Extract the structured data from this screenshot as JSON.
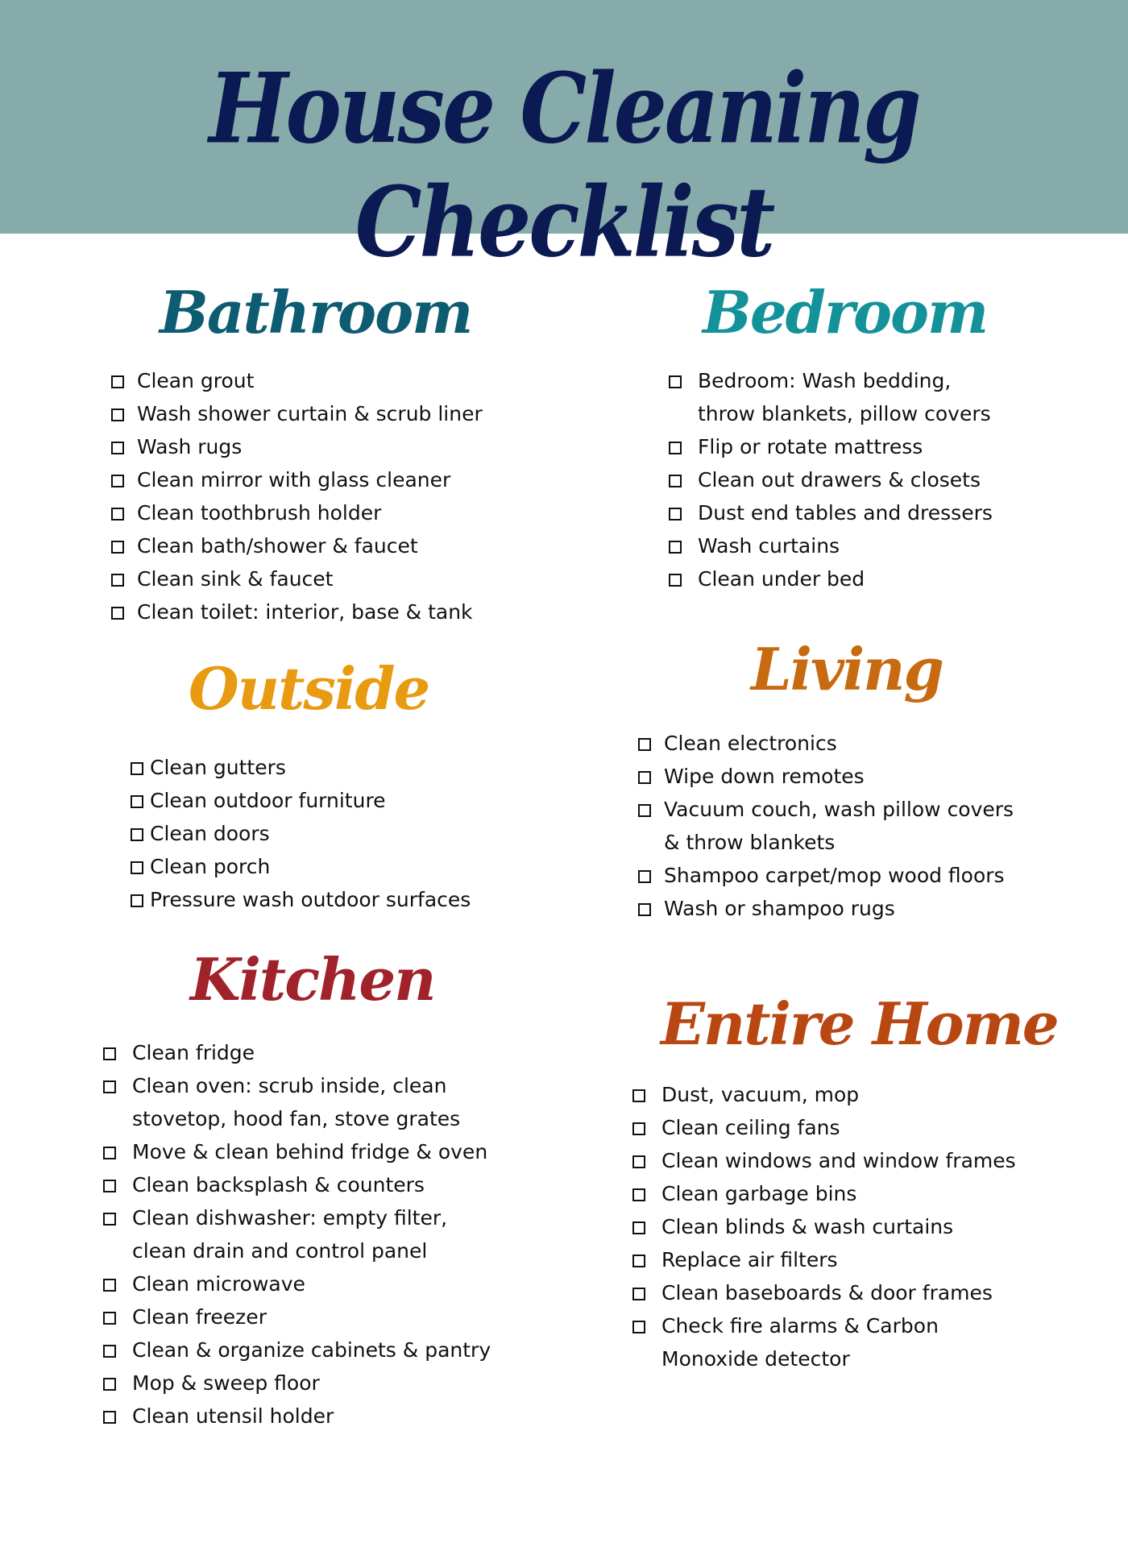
{
  "header": {
    "title": "House Cleaning Checklist",
    "background_color": "#87abaa",
    "title_color": "#0b1a52"
  },
  "sections": {
    "bathroom": {
      "heading": "Bathroom",
      "color": "#0d5c72",
      "items": [
        "Clean grout",
        "Wash shower curtain & scrub liner",
        " Wash rugs",
        "Clean mirror with glass cleaner",
        "Clean toothbrush holder",
        "Clean bath/shower & faucet",
        "Clean sink & faucet",
        "Clean toilet: interior, base & tank"
      ]
    },
    "bedroom": {
      "heading": "Bedroom",
      "color": "#14929a",
      "items": [
        "Bedroom: Wash bedding, throw blankets, pillow covers",
        "Flip or rotate mattress",
        "Clean out drawers & closets",
        "Dust end tables and dressers",
        "Wash curtains",
        "Clean under bed"
      ]
    },
    "outside": {
      "heading": "Outside",
      "color": "#e89a10",
      "items": [
        "Clean gutters",
        "Clean outdoor furniture",
        "Clean doors",
        "Clean porch",
        "Pressure wash outdoor surfaces"
      ]
    },
    "living": {
      "heading": "Living",
      "color": "#c86a10",
      "items": [
        "Clean electronics",
        "Wipe down remotes",
        "Vacuum couch, wash pillow covers & throw blankets",
        "Shampoo carpet/mop wood floors",
        "Wash or shampoo rugs"
      ]
    },
    "kitchen": {
      "heading": "Kitchen",
      "color": "#a0222a",
      "items": [
        "Clean fridge",
        "Clean oven: scrub inside, clean stovetop, hood fan, stove grates",
        "Move & clean behind fridge & oven",
        "Clean backsplash & counters",
        "Clean dishwasher: empty filter, clean drain and control panel",
        "Clean microwave",
        "Clean freezer",
        "Clean & organize cabinets & pantry",
        "Mop & sweep floor",
        "Clean utensil holder"
      ]
    },
    "entire_home": {
      "heading": "Entire Home",
      "color": "#b84712",
      "items": [
        "Dust, vacuum, mop",
        "Clean ceiling fans",
        "Clean windows and window frames",
        "Clean garbage bins",
        "Clean blinds & wash curtains",
        "Replace air filters",
        "Clean baseboards & door frames",
        "Check fire alarms & Carbon Monoxide detector"
      ]
    }
  }
}
